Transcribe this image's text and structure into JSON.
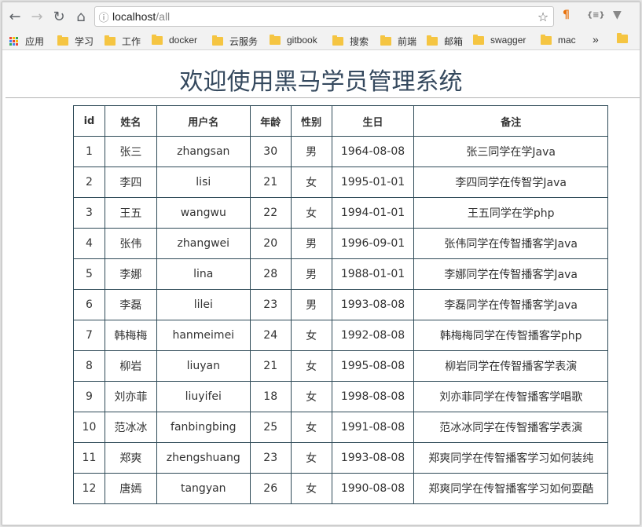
{
  "browser": {
    "url_host": "localhost",
    "url_path": "/all",
    "bookmarks": [
      {
        "label": "应用",
        "icon": "apps-icon"
      },
      {
        "label": "学习",
        "icon": "folder-icon"
      },
      {
        "label": "工作",
        "icon": "folder-icon"
      },
      {
        "label": "docker",
        "icon": "folder-icon"
      },
      {
        "label": "云服务",
        "icon": "folder-icon"
      },
      {
        "label": "gitbook",
        "icon": "folder-icon"
      },
      {
        "label": "搜索",
        "icon": "folder-icon"
      },
      {
        "label": "前端",
        "icon": "folder-icon"
      },
      {
        "label": "邮箱",
        "icon": "folder-icon"
      },
      {
        "label": "swagger",
        "icon": "folder-icon"
      },
      {
        "label": "mac",
        "icon": "folder-icon"
      }
    ],
    "overflow_label": "»"
  },
  "page": {
    "title": "欢迎使用黑马学员管理系统"
  },
  "table": {
    "headers": [
      "id",
      "姓名",
      "用户名",
      "年龄",
      "性别",
      "生日",
      "备注"
    ],
    "rows": [
      [
        "1",
        "张三",
        "zhangsan",
        "30",
        "男",
        "1964-08-08",
        "张三同学在学Java"
      ],
      [
        "2",
        "李四",
        "lisi",
        "21",
        "女",
        "1995-01-01",
        "李四同学在传智学Java"
      ],
      [
        "3",
        "王五",
        "wangwu",
        "22",
        "女",
        "1994-01-01",
        "王五同学在学php"
      ],
      [
        "4",
        "张伟",
        "zhangwei",
        "20",
        "男",
        "1996-09-01",
        "张伟同学在传智播客学Java"
      ],
      [
        "5",
        "李娜",
        "lina",
        "28",
        "男",
        "1988-01-01",
        "李娜同学在传智播客学Java"
      ],
      [
        "6",
        "李磊",
        "lilei",
        "23",
        "男",
        "1993-08-08",
        "李磊同学在传智播客学Java"
      ],
      [
        "7",
        "韩梅梅",
        "hanmeimei",
        "24",
        "女",
        "1992-08-08",
        "韩梅梅同学在传智播客学php"
      ],
      [
        "8",
        "柳岩",
        "liuyan",
        "21",
        "女",
        "1995-08-08",
        "柳岩同学在传智播客学表演"
      ],
      [
        "9",
        "刘亦菲",
        "liuyifei",
        "18",
        "女",
        "1998-08-08",
        "刘亦菲同学在传智播客学唱歌"
      ],
      [
        "10",
        "范冰冰",
        "fanbingbing",
        "25",
        "女",
        "1991-08-08",
        "范冰冰同学在传智播客学表演"
      ],
      [
        "11",
        "郑爽",
        "zhengshuang",
        "23",
        "女",
        "1993-08-08",
        "郑爽同学在传智播客学习如何装纯"
      ],
      [
        "12",
        "唐嫣",
        "tangyan",
        "26",
        "女",
        "1990-08-08",
        "郑爽同学在传智播客学习如何耍酷"
      ]
    ]
  }
}
